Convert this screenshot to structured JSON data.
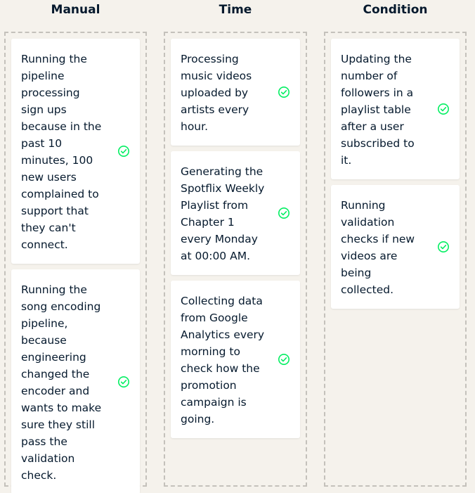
{
  "colors": {
    "background": "#f5f2ec",
    "card": "#ffffff",
    "text": "#05192d",
    "check": "#03ef62",
    "dashed_border": "#c4c1bb"
  },
  "columns": [
    {
      "title": "Manual",
      "cards": [
        {
          "text": "Running the pipeline processing sign ups because in the past 10 minutes, 100 new users complained to support that they can't connect.",
          "icon": "check-circle-icon"
        },
        {
          "text": "Running the song encoding pipeline, because engineering changed the encoder and wants to make sure they still pass the validation check.",
          "icon": "check-circle-icon"
        }
      ]
    },
    {
      "title": "Time",
      "cards": [
        {
          "text": "Processing music videos uploaded by artists every hour.",
          "icon": "check-circle-icon"
        },
        {
          "text": "Generating the Spotflix Weekly Playlist from Chapter 1 every Monday at 00:00 AM.",
          "icon": "check-circle-icon"
        },
        {
          "text": "Collecting data from Google Analytics every morning to check how the promotion campaign is going.",
          "icon": "check-circle-icon"
        }
      ]
    },
    {
      "title": "Condition",
      "cards": [
        {
          "text": "Updating the number of followers in a playlist table after a user subscribed to it.",
          "icon": "check-circle-icon"
        },
        {
          "text": "Running validation checks if new videos are being collected.",
          "icon": "check-circle-icon"
        }
      ]
    }
  ]
}
